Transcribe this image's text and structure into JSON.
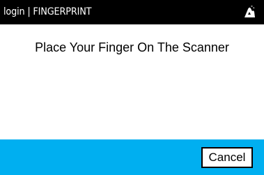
{
  "header": {
    "title": "login | FINGERPRINT",
    "logo_icon": "brand-logo-icon"
  },
  "main": {
    "prompt": "Place Your Finger On The Scanner"
  },
  "footer": {
    "cancel_label": "Cancel"
  },
  "colors": {
    "header_bg": "#000000",
    "footer_bg": "#00aff0",
    "text": "#000000"
  }
}
